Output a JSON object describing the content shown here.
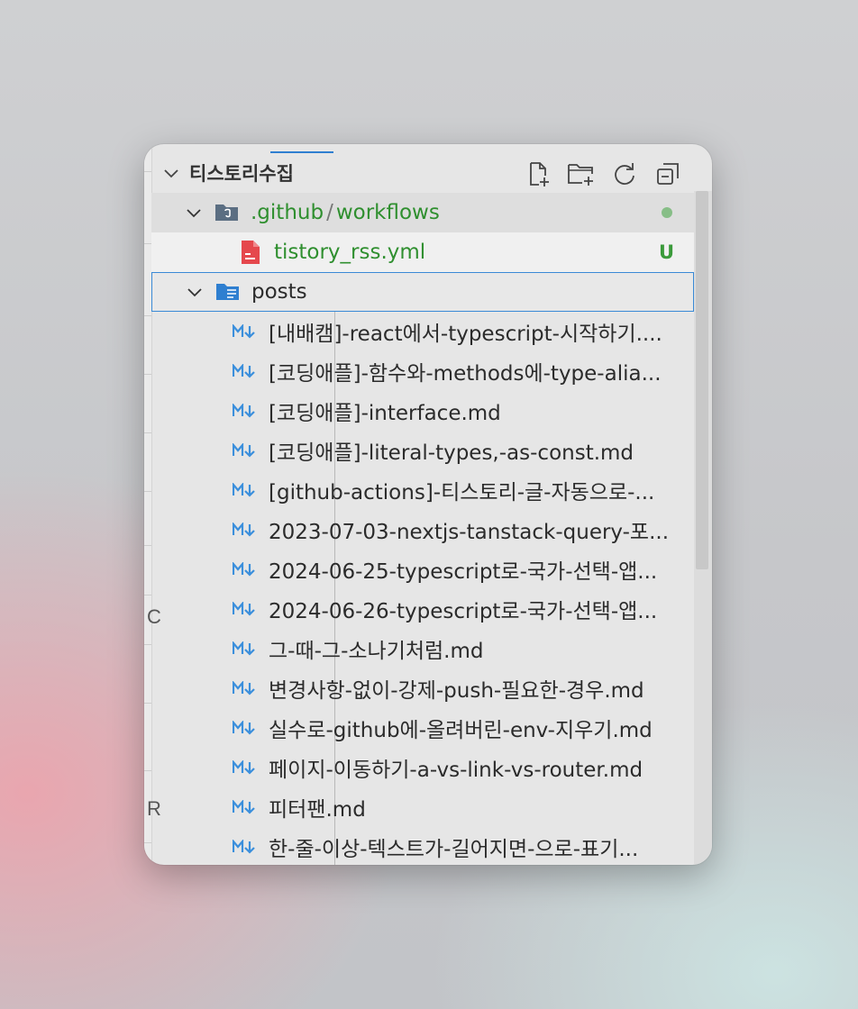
{
  "explorer": {
    "title": "티스토리수집",
    "actions": [
      {
        "name": "new-file-icon"
      },
      {
        "name": "new-folder-icon"
      },
      {
        "name": "refresh-icon"
      },
      {
        "name": "collapse-all-icon"
      }
    ]
  },
  "tree": {
    "github_folder": {
      "part1": ".github",
      "sep": "/",
      "part2": "workflows",
      "status": "modified-dot"
    },
    "workflow_file": {
      "name": "tistory_rss.yml",
      "status": "U"
    },
    "posts_folder": {
      "name": "posts"
    },
    "posts": [
      "[내배캠]-react에서-typescript-시작하기....",
      "[코딩애플]-함수와-methods에-type-alia...",
      "[코딩애플]-interface.md",
      "[코딩애플]-literal-types,-as-const.md",
      "[github-actions]-티스토리-글-자동으로-...",
      "2023-07-03-nextjs-tanstack-query-포...",
      "2024-06-25-typescript로-국가-선택-앱...",
      "2024-06-26-typescript로-국가-선택-앱...",
      "그-때-그-소나기처럼.md",
      "변경사항-없이-강제-push-필요한-경우.md",
      "실수로-github에-올려버린-env-지우기.md",
      "페이지-이동하기-a-vs-link-vs-router.md",
      "피터팬.md",
      "한-줄-이상-텍스트가-길어지면-으로-표기..."
    ]
  },
  "left_strip": {
    "glyph_a": "C",
    "glyph_b": "R"
  },
  "colors": {
    "accent": "#2f7fd0",
    "git_added": "#2f8f2f",
    "markdown_icon": "#3b8fdc",
    "yaml_icon": "#e5484d"
  }
}
